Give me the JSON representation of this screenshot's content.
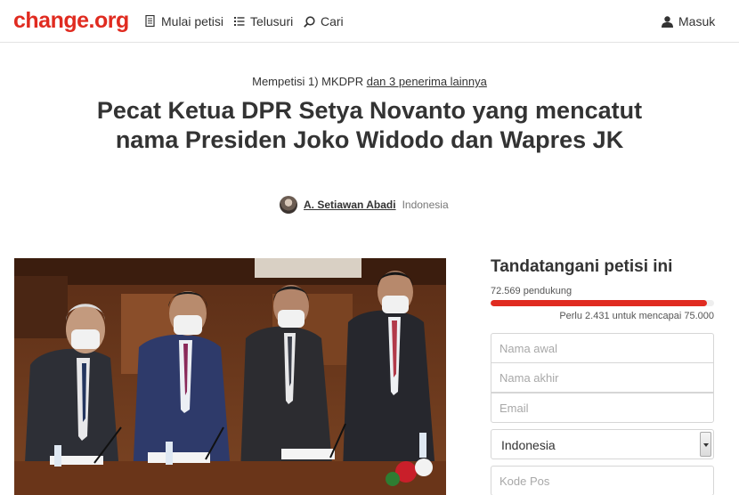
{
  "header": {
    "logo": "change.org",
    "nav": {
      "start": "Mulai petisi",
      "browse": "Telusuri",
      "search": "Cari",
      "login": "Masuk"
    }
  },
  "petition": {
    "to_prefix": "Mempetisi 1) MKDPR",
    "to_more": "dan 3 penerima lainnya",
    "title": "Pecat Ketua DPR Setya Novanto yang mencatut nama Presiden Joko Widodo dan Wapres JK",
    "author_name": "A. Setiawan Abadi",
    "author_location": "Indonesia"
  },
  "sign": {
    "title": "Tandatangani petisi ini",
    "supporters": "72.569 pendukung",
    "progress_fraction": 0.9676,
    "goal_text": "Perlu 2.431 untuk mencapai 75.000",
    "first_name_placeholder": "Nama awal",
    "last_name_placeholder": "Nama akhir",
    "email_placeholder": "Email",
    "country_value": "Indonesia",
    "postal_placeholder": "Kode Pos"
  },
  "colors": {
    "brand": "#e02b20",
    "text": "#333333",
    "muted": "#777777"
  },
  "icons": {
    "start": "document-icon",
    "browse": "list-icon",
    "search": "search-icon",
    "login": "user-icon"
  }
}
